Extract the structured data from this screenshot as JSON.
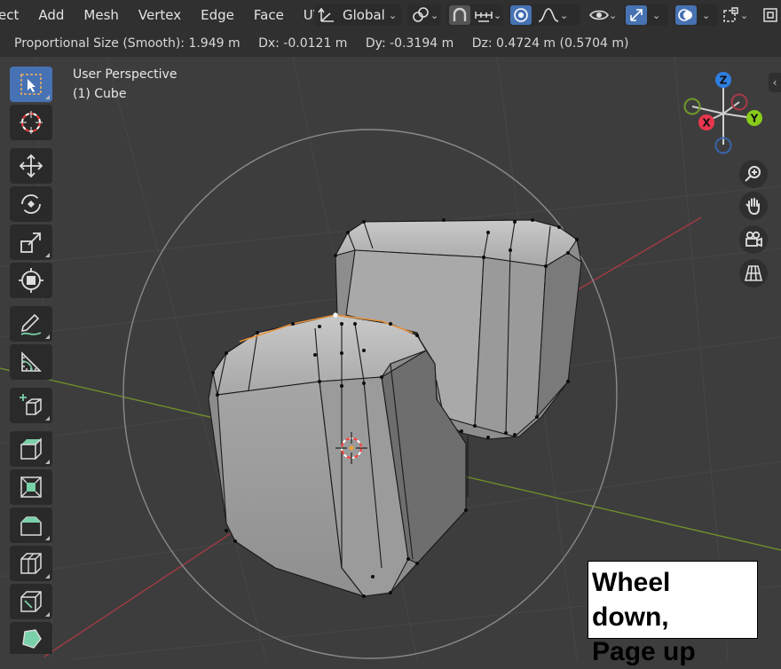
{
  "menu": {
    "items": [
      "ect",
      "Add",
      "Mesh",
      "Vertex",
      "Edge",
      "Face",
      "UV"
    ]
  },
  "header": {
    "orientation_label": "Global"
  },
  "status": {
    "proportional_size": "Proportional Size (Smooth): 1.949 m",
    "dx": "Dx: -0.0121 m",
    "dy": "Dy: -0.3194 m",
    "dz": "Dz: 0.4724 m (0.5704 m)"
  },
  "viewport": {
    "view_name": "User Perspective",
    "object_name": "(1) Cube"
  },
  "gizmo": {
    "z_label": "Z",
    "x_label": "X",
    "y_label": "Y"
  },
  "callout": {
    "line1": "Wheel down,",
    "line2": "Page up"
  },
  "toolbar": {
    "tools": [
      "select-box",
      "cursor",
      "move",
      "rotate",
      "scale",
      "transform",
      "annotate",
      "measure",
      "add-cube",
      "extrude-region",
      "inset-faces",
      "bevel",
      "loop-cut",
      "knife",
      "poly-build"
    ]
  },
  "colors": {
    "header_bg": "#303030",
    "viewport_bg": "#3d3d3d",
    "active_blue": "#4772b3",
    "x_axis": "#ff3352",
    "y_axis": "#8bdc00",
    "z_axis": "#2890ff"
  }
}
